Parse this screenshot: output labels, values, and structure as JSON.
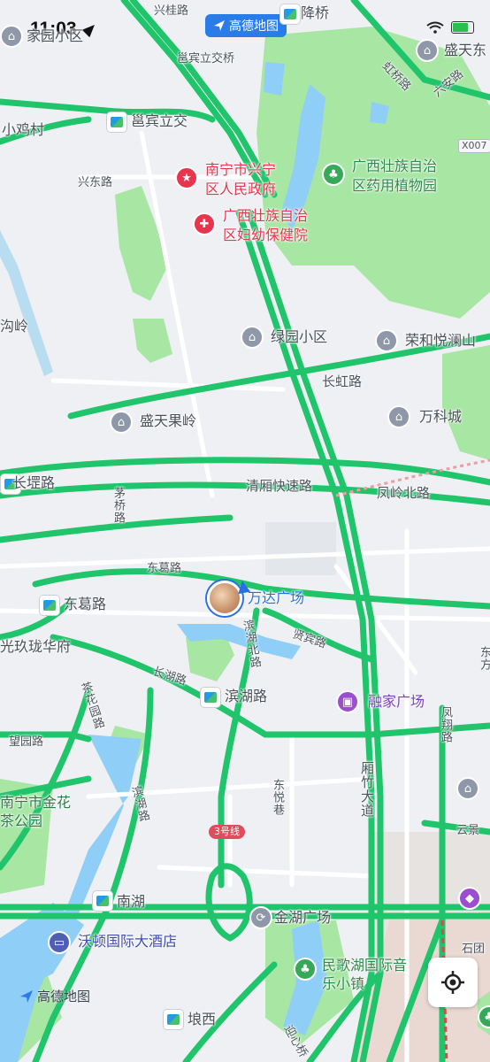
{
  "status_bar": {
    "time": "11:03"
  },
  "app_pill": {
    "label": "高德地图"
  },
  "watermark": {
    "label": "高德地图"
  },
  "colors": {
    "road": "#1fc46b",
    "park": "#a8e6a4",
    "water": "#8fcff7",
    "background": "#eef0f3",
    "accent": "#2a6fe0"
  },
  "map": {
    "place_labels": [
      {
        "id": "xinggui-road",
        "text": "兴桂路"
      },
      {
        "id": "jiangqiao",
        "text": "降桥"
      },
      {
        "id": "jiayuan",
        "text": "家园小区"
      },
      {
        "id": "shengtian-east",
        "text": "盛天东"
      },
      {
        "id": "yongbin-interchange-top",
        "text": "邕宾立交桥"
      },
      {
        "id": "honggiao-road",
        "text": "虹桥路"
      },
      {
        "id": "liuan-road",
        "text": "六安路"
      },
      {
        "id": "xiaoji-village",
        "text": "小鸡村"
      },
      {
        "id": "yongbin-interchange",
        "text": "邕宾立交"
      },
      {
        "id": "xingdong-road",
        "text": "兴东路"
      },
      {
        "id": "gouling",
        "text": "沟岭"
      },
      {
        "id": "lvyuan",
        "text": "绿园小区"
      },
      {
        "id": "ronghe",
        "text": "荣和悦澜山"
      },
      {
        "id": "changhong-road",
        "text": "长虹路"
      },
      {
        "id": "shengtian-guoling",
        "text": "盛天果岭"
      },
      {
        "id": "vanke",
        "text": "万科城"
      },
      {
        "id": "changgang-road",
        "text": "长堽路"
      },
      {
        "id": "qingyong-expressway",
        "text": "清厢快速路"
      },
      {
        "id": "fengling-north",
        "text": "凤岭北路"
      },
      {
        "id": "maoqiao-road",
        "text": "茅桥路"
      },
      {
        "id": "dongge-road-top",
        "text": "东葛路"
      },
      {
        "id": "dongge-road",
        "text": "东葛路"
      },
      {
        "id": "wanda",
        "text": "万达广场"
      },
      {
        "id": "binhu-north",
        "text": "滨湖北路"
      },
      {
        "id": "xianbin-road",
        "text": "贤宾路"
      },
      {
        "id": "guangjiu",
        "text": "光玖珑华府"
      },
      {
        "id": "changhu-road",
        "text": "长湖路"
      },
      {
        "id": "binhu-road",
        "text": "滨湖路"
      },
      {
        "id": "rongjia",
        "text": "融家广场"
      },
      {
        "id": "chahua-road",
        "text": "茶花园路"
      },
      {
        "id": "wangyuan-road",
        "text": "望园路"
      },
      {
        "id": "fengxiang-road",
        "text": "凤翔路"
      },
      {
        "id": "dongyue",
        "text": "东悦巷"
      },
      {
        "id": "xiangzhu",
        "text": "厢竹大道"
      },
      {
        "id": "chahua-park",
        "text": "南宁市金花茶公园"
      },
      {
        "id": "binhu-vert",
        "text": "滨湖路"
      },
      {
        "id": "yunjing",
        "text": "云景"
      },
      {
        "id": "nanhu",
        "text": "南湖"
      },
      {
        "id": "jinhu",
        "text": "金湖广场"
      },
      {
        "id": "walton",
        "text": "沃顿国际大酒店"
      },
      {
        "id": "minge",
        "text": "民歌湖国际音乐小镇"
      },
      {
        "id": "shitou",
        "text": "石团"
      },
      {
        "id": "langxi",
        "text": "埌西"
      },
      {
        "id": "jinxin-bridge",
        "text": "迎心桥"
      },
      {
        "id": "fengling-vert",
        "text": "东方"
      }
    ],
    "pois": [
      {
        "id": "xingning-gov",
        "text": "南宁市兴宁区人民政府",
        "line1": "南宁市兴宁",
        "line2": "区人民政府"
      },
      {
        "id": "maternal",
        "text": "广西壮族自治区妇幼保健院",
        "line1": "广西壮族自治",
        "line2": "区妇幼保健院"
      },
      {
        "id": "herb-garden",
        "text": "广西壮族自治区药用植物园",
        "line1": "广西壮族自治",
        "line2": "区药用植物园"
      }
    ],
    "shields": [
      {
        "id": "x007",
        "text": "X007"
      },
      {
        "id": "line3",
        "text": "3号线"
      }
    ]
  },
  "locate_button": {
    "icon": "locate-icon"
  }
}
